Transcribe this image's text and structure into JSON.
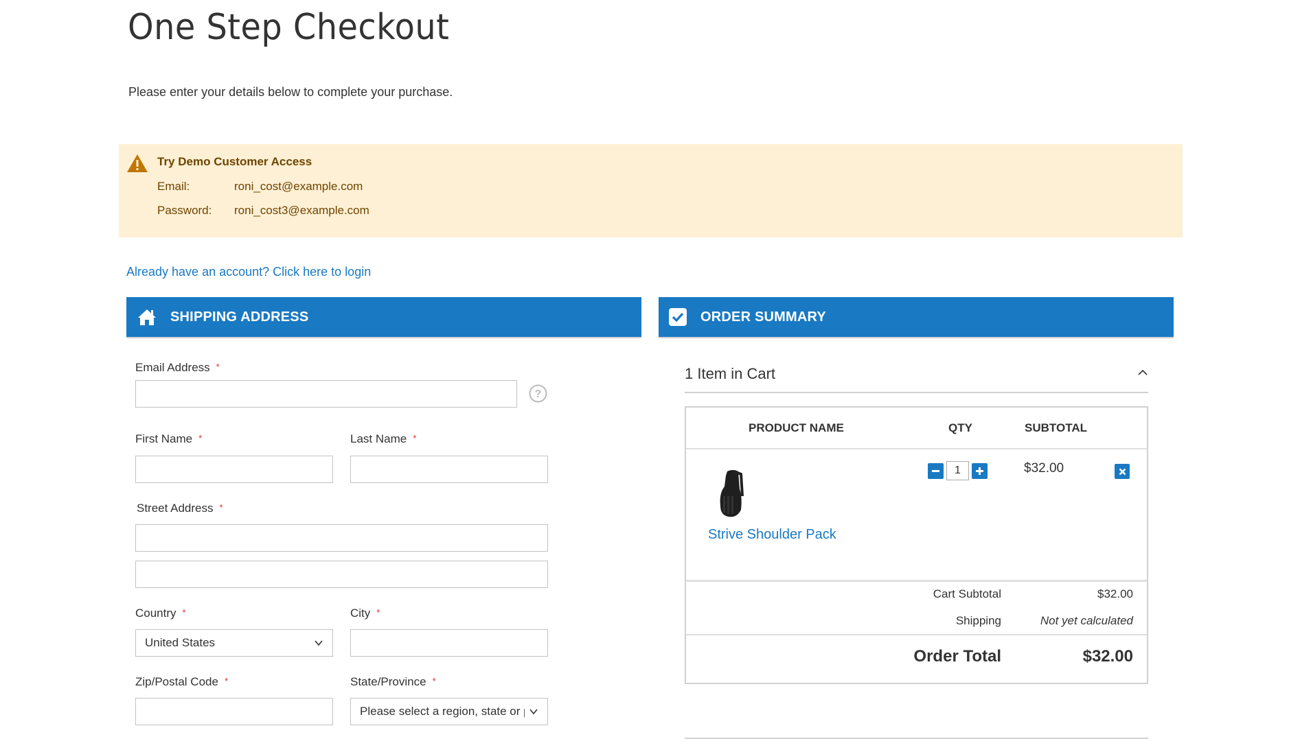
{
  "page": {
    "title": "One Step Checkout",
    "subtitle": "Please enter your details below to complete your purchase."
  },
  "demo_notice": {
    "icon": "warning-icon",
    "title": "Try Demo Customer Access",
    "rows": [
      {
        "label": "Email:",
        "value": "roni_cost@example.com"
      },
      {
        "label": "Password:",
        "value": "roni_cost3@example.com"
      }
    ]
  },
  "login_link": "Already have an account? Click here to login",
  "shipping": {
    "header": "SHIPPING ADDRESS",
    "header_icon": "home-icon",
    "fields": {
      "email": {
        "label": "Email Address",
        "required": "*",
        "value": "",
        "help_icon": "question-circle-icon"
      },
      "first_name": {
        "label": "First Name",
        "required": "*",
        "value": ""
      },
      "last_name": {
        "label": "Last Name",
        "required": "*",
        "value": ""
      },
      "street": {
        "label": "Street Address",
        "required": "*",
        "line1": "",
        "line2": ""
      },
      "country": {
        "label": "Country",
        "required": "*",
        "selected": "United States"
      },
      "city": {
        "label": "City",
        "required": "*",
        "value": ""
      },
      "zip": {
        "label": "Zip/Postal Code",
        "required": "*",
        "value": ""
      },
      "state": {
        "label": "State/Province",
        "required": "*",
        "selected": "Please select a region, state or province."
      }
    }
  },
  "summary": {
    "header": "ORDER SUMMARY",
    "header_icon": "checkbox-checked-icon",
    "cart_count": "1 Item in Cart",
    "columns": [
      "PRODUCT NAME",
      "QTY",
      "SUBTOTAL"
    ],
    "items": [
      {
        "name": "Strive Shoulder Pack",
        "qty": "1",
        "subtotal": "$32.00",
        "image": "shoulder-pack-image"
      }
    ],
    "totals": {
      "cart_subtotal_label": "Cart Subtotal",
      "cart_subtotal_value": "$32.00",
      "shipping_label": "Shipping",
      "shipping_value": "Not yet calculated",
      "order_total_label": "Order Total",
      "order_total_value": "$32.00"
    }
  },
  "colors": {
    "primary": "#1979c3",
    "notice_bg": "#fdf0d5",
    "notice_text": "#6f4400",
    "required": "#e02b27"
  }
}
